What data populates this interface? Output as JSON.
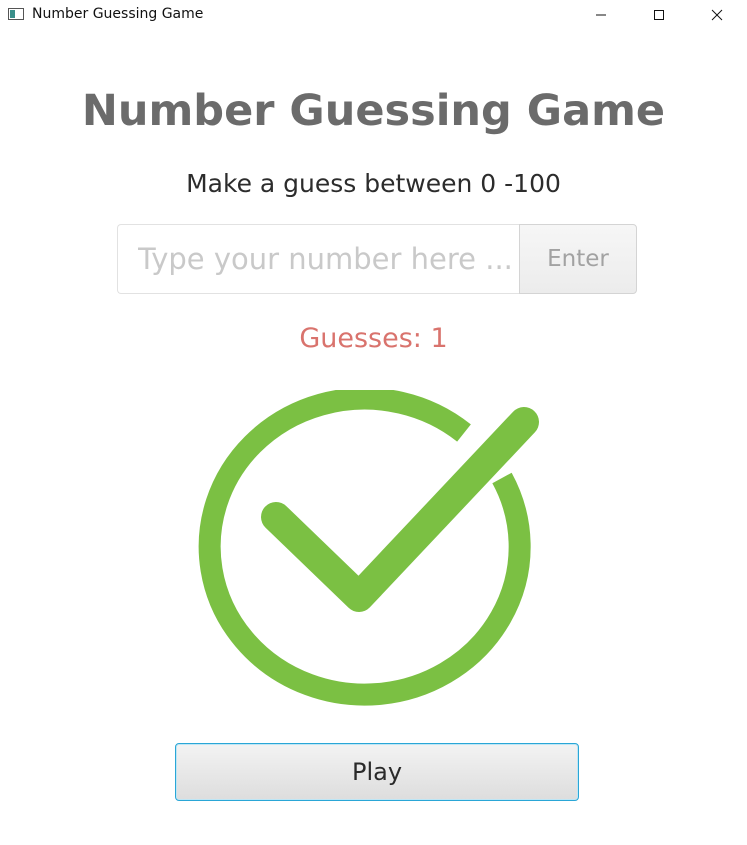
{
  "window": {
    "title": "Number Guessing Game"
  },
  "game": {
    "title": "Number Guessing Game",
    "prompt": "Make a guess between 0 -100",
    "input_placeholder": "Type your number here ...",
    "input_value": "",
    "enter_label": "Enter",
    "guesses_text": "Guesses: 1",
    "result_icon": "check-circle-icon",
    "play_label": "Play"
  },
  "colors": {
    "title_gray": "#6b6b6b",
    "guesses_red": "#d9736d",
    "check_green": "#7bc043",
    "focus_blue": "#2aa6d6"
  }
}
